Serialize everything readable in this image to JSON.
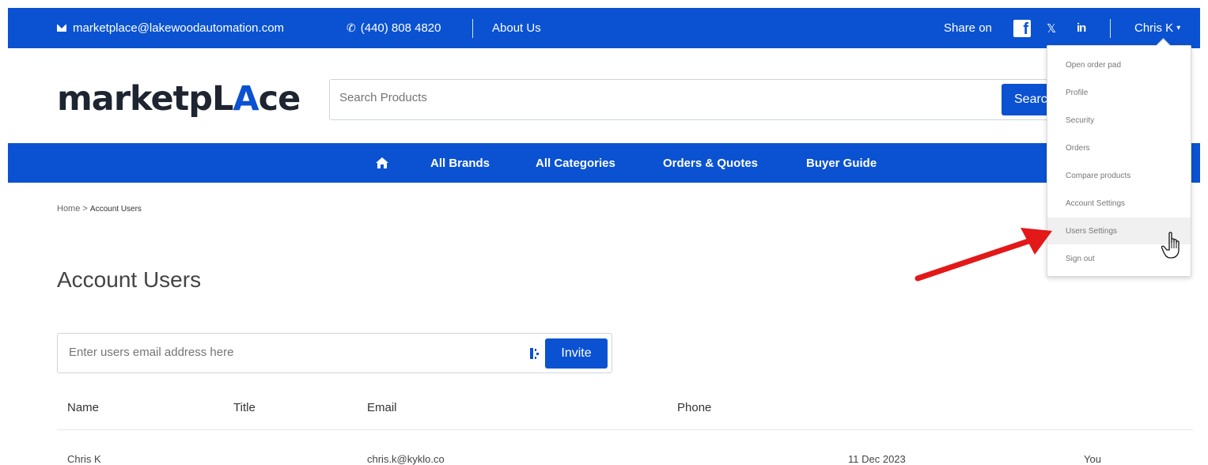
{
  "topbar": {
    "email": "marketplace@lakewoodautomation.com",
    "phone": "(440) 808 4820",
    "about": "About Us",
    "share_on": "Share on",
    "social": {
      "facebook": "f",
      "x": "𝕏",
      "linkedin": "in"
    },
    "user": "Chris K",
    "user_caret": "▾"
  },
  "logo": {
    "part1": "marketp",
    "part2": "L",
    "part3": "A",
    "part4": "ce"
  },
  "search": {
    "placeholder": "Search Products",
    "button": "Search"
  },
  "nav": {
    "home_icon": "house-icon",
    "items": [
      "All Brands",
      "All Categories",
      "Orders & Quotes",
      "Buyer Guide"
    ]
  },
  "breadcrumb": {
    "home": "Home",
    "separator": ">",
    "current": "Account Users"
  },
  "page_title": "Account Users",
  "invite": {
    "placeholder": "Enter users email address here",
    "button": "Invite"
  },
  "table": {
    "headers": [
      "Name",
      "Title",
      "Email",
      "Phone"
    ],
    "rows": [
      {
        "name": "Chris K",
        "title": "",
        "email": "chris.k@kyklo.co",
        "phone": "",
        "date": "11 Dec 2023",
        "status": "You"
      }
    ]
  },
  "dropdown": {
    "items": [
      "Open order pad",
      "Profile",
      "Security",
      "Orders",
      "Compare products",
      "Account Settings",
      "Users Settings",
      "Sign out"
    ],
    "active": "Users Settings"
  },
  "colors": {
    "brand": "#0a52d1",
    "annotation_arrow": "#e31818"
  }
}
